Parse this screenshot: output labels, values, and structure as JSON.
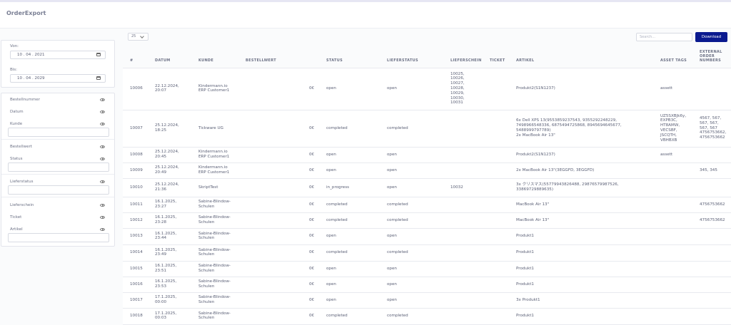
{
  "app": {
    "title": "OrderExport"
  },
  "dates": {
    "from_label": "Von:",
    "from_value": "10 . 04 . 2021",
    "to_label": "Bis:",
    "to_value": "10 . 04 . 2029"
  },
  "filters": [
    {
      "label": "Bestellnummer",
      "has_input": false
    },
    {
      "label": "Datum",
      "has_input": false
    },
    {
      "label": "Kunde",
      "has_input": true
    },
    {
      "label": "Bestellwert",
      "has_input": false
    },
    {
      "label": "Status",
      "has_input": true
    },
    {
      "label": "Lieferstatus",
      "has_input": true
    },
    {
      "label": "Lieferschein",
      "has_input": false
    },
    {
      "label": "Ticket",
      "has_input": false
    },
    {
      "label": "Artikel",
      "has_input": true
    }
  ],
  "toolbar": {
    "page_size": "25",
    "search_placeholder": "Search...",
    "download_label": "Download"
  },
  "table": {
    "headers": [
      "#",
      "DATUM",
      "KUNDE",
      "BESTELLWERT",
      "STATUS",
      "LIEFERSTATUS",
      "LIEFERSCHEIN",
      "TICKET",
      "ARTIKEL",
      "ASSET TAGS",
      "EXTERNAL\nORDER\nNUMBERS"
    ],
    "rows": [
      {
        "id": "10006",
        "datum": "22.12.2024,\n20:07",
        "kunde": "Kindermann.io\nERP Customer1",
        "wert": "0€",
        "status": "open",
        "liefer": "open",
        "schein": "10025,\n10026,\n10027,\n10028,\n10029,\n10030,\n10031",
        "ticket": "",
        "artikel": "Produkt2(S1N1237)",
        "tags": "assett",
        "ext": ""
      },
      {
        "id": "10007",
        "datum": "25.12.2024,\n18:25",
        "kunde": "Tickware UG",
        "wert": "0€",
        "status": "completed",
        "liefer": "completed",
        "schein": "",
        "ticket": "",
        "artikel": "6x Dell XPS 13(9553859237543, 9355292248229,\n7498966548336, 6875494725868, 8945694645677,\n5488999797789)\n2x MacBook Air 13\"",
        "tags": "UZ5SXBJk6y,\nEXPB3C,\nHT8AMW,\nVECSBF,\nJSCQTH,\nVBHBXB",
        "ext": "4567, 567,\n567, 567,\n567, 567\n4756753662,\n4756753662"
      },
      {
        "id": "10008",
        "datum": "25.12.2024,\n20:45",
        "kunde": "Kindermann.io\nERP Customer1",
        "wert": "0€",
        "status": "open",
        "liefer": "open",
        "schein": "",
        "ticket": "",
        "artikel": "Produkt2(S1N1237)",
        "tags": "assett",
        "ext": ""
      },
      {
        "id": "10009",
        "datum": "25.12.2024,\n20:49",
        "kunde": "Kindermann.io\nERP Customer1",
        "wert": "0€",
        "status": "open",
        "liefer": "open",
        "schein": "",
        "ticket": "",
        "artikel": "2x MacBook Air 13\"(3EGGFD, 3EGGFD)",
        "tags": "",
        "ext": "345, 345"
      },
      {
        "id": "10010",
        "datum": "25.12.2024,\n21:36",
        "kunde": "SkriptTest",
        "wert": "0€",
        "status": "in_progress",
        "liefer": "open",
        "schein": "10032",
        "ticket": "",
        "artikel": "3x クリスマス(55779943826488, 29876579987526,\n33869729889635)",
        "tags": "",
        "ext": ""
      },
      {
        "id": "10011",
        "datum": "16.1.2025,\n23:27",
        "kunde": "Sabine-Blindow-\nSchulen",
        "wert": "0€",
        "status": "completed",
        "liefer": "completed",
        "schein": "",
        "ticket": "",
        "artikel": "MacBook Air 13\"",
        "tags": "",
        "ext": "4756753662"
      },
      {
        "id": "10012",
        "datum": "16.1.2025,\n23:28",
        "kunde": "Sabine-Blindow-\nSchulen",
        "wert": "0€",
        "status": "completed",
        "liefer": "completed",
        "schein": "",
        "ticket": "",
        "artikel": "MacBook Air 13\"",
        "tags": "",
        "ext": "4756753662"
      },
      {
        "id": "10013",
        "datum": "16.1.2025,\n23:44",
        "kunde": "Sabine-Blindow-\nSchulen",
        "wert": "0€",
        "status": "open",
        "liefer": "open",
        "schein": "",
        "ticket": "",
        "artikel": "Produkt1",
        "tags": "",
        "ext": ""
      },
      {
        "id": "10014",
        "datum": "16.1.2025,\n23:49",
        "kunde": "Sabine-Blindow-\nSchulen",
        "wert": "0€",
        "status": "completed",
        "liefer": "completed",
        "schein": "",
        "ticket": "",
        "artikel": "Produkt1",
        "tags": "",
        "ext": ""
      },
      {
        "id": "10015",
        "datum": "16.1.2025,\n23:51",
        "kunde": "Sabine-Blindow-\nSchulen",
        "wert": "0€",
        "status": "open",
        "liefer": "open",
        "schein": "",
        "ticket": "",
        "artikel": "Produkt1",
        "tags": "",
        "ext": ""
      },
      {
        "id": "10016",
        "datum": "16.1.2025,\n23:53",
        "kunde": "Sabine-Blindow-\nSchulen",
        "wert": "0€",
        "status": "open",
        "liefer": "open",
        "schein": "",
        "ticket": "",
        "artikel": "Produkt1",
        "tags": "",
        "ext": ""
      },
      {
        "id": "10017",
        "datum": "17.1.2025,\n00:00",
        "kunde": "Sabine-Blindow-\nSchulen",
        "wert": "0€",
        "status": "open",
        "liefer": "open",
        "schein": "",
        "ticket": "",
        "artikel": "3x Produkt1",
        "tags": "",
        "ext": ""
      },
      {
        "id": "10018",
        "datum": "17.1.2025,\n00:03",
        "kunde": "Sabine-Blindow-\nSchulen",
        "wert": "0€",
        "status": "completed",
        "liefer": "completed",
        "schein": "",
        "ticket": "",
        "artikel": "Produkt1",
        "tags": "",
        "ext": ""
      }
    ]
  }
}
